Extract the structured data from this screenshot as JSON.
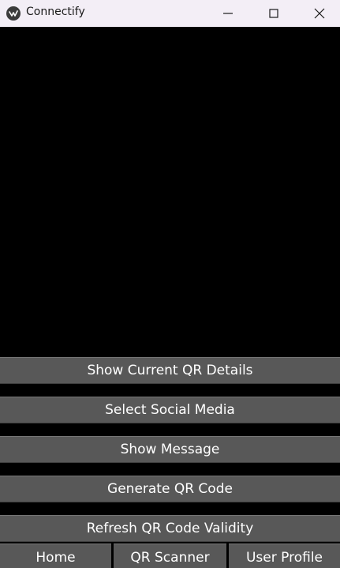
{
  "window": {
    "title": "Connectify",
    "controls": {
      "minimize": "minimize-icon",
      "maximize": "maximize-icon",
      "close": "close-icon"
    }
  },
  "actions": {
    "show_qr_details": "Show Current QR Details",
    "select_social_media": "Select Social Media",
    "show_message": "Show Message",
    "generate_qr": "Generate QR Code",
    "refresh_validity": "Refresh QR Code Validity"
  },
  "nav": {
    "home": "Home",
    "qr_scanner": "QR Scanner",
    "user_profile": "User Profile"
  },
  "colors": {
    "titlebar_bg": "#f3eef6",
    "button_bg": "#585858",
    "button_text": "#ffffff",
    "viewport_bg": "#000000"
  }
}
